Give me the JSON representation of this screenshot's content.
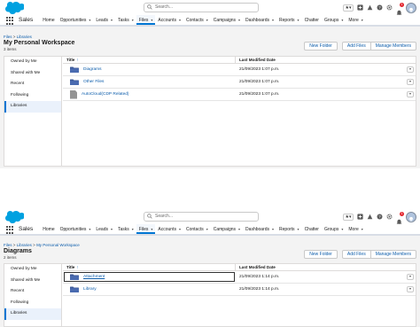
{
  "header": {
    "search_placeholder": "Search...",
    "notification_count": "1"
  },
  "nav": {
    "app_name": "Sales",
    "items": [
      {
        "label": "Home",
        "chevron": false
      },
      {
        "label": "Opportunities",
        "chevron": true
      },
      {
        "label": "Leads",
        "chevron": true
      },
      {
        "label": "Tasks",
        "chevron": true
      },
      {
        "label": "Files",
        "chevron": true
      },
      {
        "label": "Accounts",
        "chevron": true
      },
      {
        "label": "Contacts",
        "chevron": true
      },
      {
        "label": "Campaigns",
        "chevron": true
      },
      {
        "label": "Dashboards",
        "chevron": true
      },
      {
        "label": "Reports",
        "chevron": true
      },
      {
        "label": "Chatter",
        "chevron": false
      },
      {
        "label": "Groups",
        "chevron": true
      },
      {
        "label": "More",
        "chevron": true
      }
    ],
    "active": "Files"
  },
  "buttons": {
    "new_folder": "New Folder",
    "add_files": "Add Files",
    "manage_members": "Manage Members"
  },
  "sidebar": {
    "items": [
      "Owned by Me",
      "Shared with Me",
      "Recent",
      "Following",
      "Libraries"
    ],
    "active": "Libraries"
  },
  "table": {
    "col_title": "Title",
    "col_sort_arrow": "↑",
    "col_modified": "Last Modified Date",
    "row_menu_glyph": "▼"
  },
  "screens": [
    {
      "crumb_1": "Files",
      "crumb_2": "Libraries",
      "crumb_3": "",
      "title": "My Personal Workspace",
      "count": "3 items",
      "rows": [
        {
          "name": "Diagrams",
          "date": "21/09/2023 1:07 p.m.",
          "icon": "folder-icon"
        },
        {
          "name": "Other Files",
          "date": "21/09/2023 1:07 p.m.",
          "icon": "folder-icon"
        },
        {
          "name": "AutoCloud(CDP Related)",
          "date": "21/09/2023 1:07 p.m.",
          "icon": "document-icon"
        }
      ]
    },
    {
      "crumb_1": "Files",
      "crumb_2": "Libraries",
      "crumb_3": "My Personal Workspace",
      "title": "Diagrams",
      "count": "2 items",
      "rows": [
        {
          "name": "Attachment",
          "date": "21/09/2023 1:14 p.m.",
          "icon": "folder-icon"
        },
        {
          "name": "Library",
          "date": "21/09/2023 1:14 p.m.",
          "icon": "folder-icon"
        }
      ]
    }
  ],
  "colors": {
    "brand_blue": "#0176d3",
    "link_blue": "#0b5cab",
    "cloud_blue": "#00a1e0",
    "folder_blue": "#3e5b9a"
  }
}
